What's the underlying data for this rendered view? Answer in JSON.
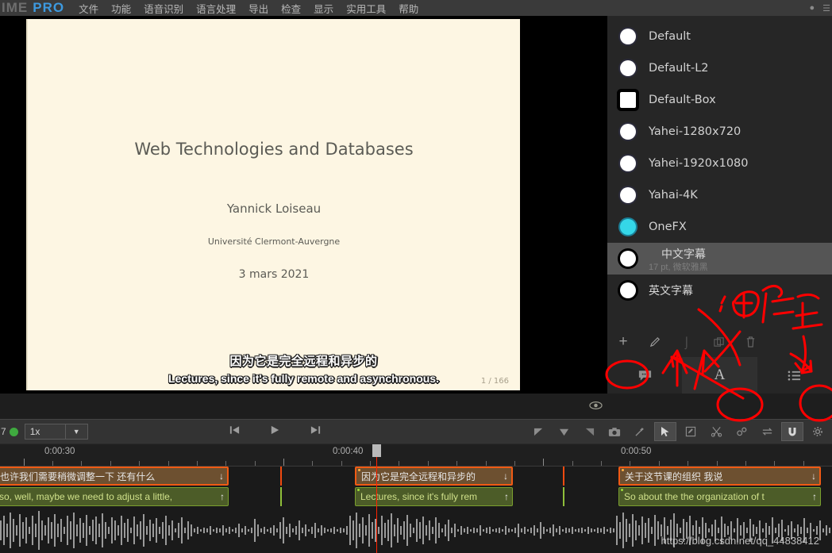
{
  "app": {
    "logo_left": "IME",
    "logo_right": "PRO",
    "menu": [
      "文件",
      "功能",
      "语音识别",
      "语言处理",
      "导出",
      "检查",
      "显示",
      "实用工具",
      "帮助"
    ]
  },
  "preview": {
    "slide": {
      "title": "Web Technologies and Databases",
      "author": "Yannick Loiseau",
      "affiliation": "Université Clermont-Auvergne",
      "date": "3 mars 2021",
      "page": "1 / 166"
    },
    "subtitle_cn": "因为它是完全远程和异步的",
    "subtitle_en": "Lectures, since it's fully remote and asynchronous."
  },
  "styles_panel": {
    "items": [
      {
        "label": "Default",
        "sub": "",
        "state": "circle"
      },
      {
        "label": "Default-L2",
        "sub": "",
        "state": "circle"
      },
      {
        "label": "Default-Box",
        "sub": "",
        "state": "square"
      },
      {
        "label": "Yahei-1280x720",
        "sub": "",
        "state": "circle"
      },
      {
        "label": "Yahei-1920x1080",
        "sub": "",
        "state": "circle"
      },
      {
        "label": "Yahai-4K",
        "sub": "",
        "state": "circle"
      },
      {
        "label": "OneFX",
        "sub": "",
        "state": "on"
      },
      {
        "label": "中文字幕",
        "sub": "17 pt, 微软雅黑",
        "state": "sel-box"
      },
      {
        "label": "英文字幕",
        "sub": "",
        "state": "sel-box"
      }
    ],
    "selected_index": 7,
    "accent_color": "#35d7e8",
    "tools": [
      {
        "name": "add-style-button",
        "glyph": "+"
      },
      {
        "name": "edit-style-button",
        "glyph": "✏"
      },
      {
        "name": "rename-style-button",
        "glyph": "I"
      },
      {
        "name": "duplicate-style-button",
        "glyph": "❐"
      },
      {
        "name": "delete-style-button",
        "glyph": "🗑"
      }
    ],
    "tabs": [
      {
        "name": "tab-subtitles",
        "glyph": "💬",
        "active": false
      },
      {
        "name": "tab-styles",
        "glyph": "A",
        "active": true
      },
      {
        "name": "tab-list",
        "glyph": "☰",
        "active": false
      }
    ]
  },
  "transport": {
    "track_index": "7",
    "speed": "1x",
    "buttons": [
      {
        "name": "jump-to-start-button",
        "glyph": "|◀"
      },
      {
        "name": "play-button",
        "glyph": "▶"
      },
      {
        "name": "jump-to-end-button",
        "glyph": "▶|"
      }
    ],
    "right_tools": [
      {
        "name": "marker-in-icon",
        "glyph": "◣",
        "active": false
      },
      {
        "name": "marker-down-icon",
        "glyph": "▼",
        "active": false
      },
      {
        "name": "marker-out-icon",
        "glyph": "◢",
        "active": false
      },
      {
        "name": "snapshot-icon",
        "glyph": "📷",
        "active": false
      },
      {
        "name": "magic-wand-icon",
        "glyph": "✧",
        "active": false
      },
      {
        "name": "select-tool-icon",
        "glyph": "➤",
        "active": true
      },
      {
        "name": "edit-tool-icon",
        "glyph": "✎",
        "active": false
      },
      {
        "name": "cut-tool-icon",
        "glyph": "✂",
        "active": false
      },
      {
        "name": "link-tool-icon",
        "glyph": "∞",
        "active": false
      },
      {
        "name": "swap-tool-icon",
        "glyph": "⇄",
        "active": false
      },
      {
        "name": "magnet-tool-icon",
        "glyph": "U",
        "active": true
      },
      {
        "name": "settings-icon",
        "glyph": "⚙",
        "active": false
      }
    ]
  },
  "timeline": {
    "ruler_labels": [
      "0:00:30",
      "0:00:40",
      "0:00:50"
    ],
    "clips_cn": [
      {
        "text": "也许我们需要稍微调整一下 还有什么"
      },
      {
        "text": "因为它是完全远程和异步的"
      },
      {
        "text": "关于这节课的组织 我说"
      }
    ],
    "clips_en": [
      {
        "text": "so, well, maybe we need to adjust a little, "
      },
      {
        "text": "Lectures, since it's fully rem"
      },
      {
        "text": "So about the the organization of t"
      }
    ]
  },
  "watermark": "https://blog.csdn.net/qq_44838412"
}
